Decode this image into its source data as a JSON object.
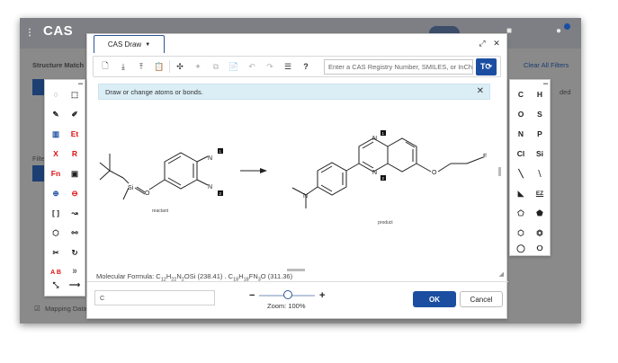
{
  "background": {
    "logo": "CAS",
    "left_panel": {
      "structure_match": "Structure Match",
      "clear_all_filters": "Clear All Filters",
      "filter_label": "Filte",
      "mapping_data": "Mapping Data",
      "right_dropdown": "ded"
    }
  },
  "dialog": {
    "tab_label": "CAS Draw",
    "expand_icon": "expand-icon",
    "close_icon": "close-icon",
    "search": {
      "placeholder": "Enter a CAS Registry Number, SMILES, or InChI..."
    },
    "info_message": "Draw or change atoms or bonds.",
    "reactant_label": "reactant",
    "product_label": "product",
    "atom_labels": {
      "n": "N",
      "si": "Si",
      "o": "O",
      "f": "F",
      "map1": "1",
      "map2": "2"
    },
    "formula": {
      "prefix": "Molecular Formula: ",
      "r_c": "C",
      "r_c_sub": "12",
      "r_h": "H",
      "r_h_sub": "22",
      "r_n": "N",
      "r_n_sub": "2",
      "r_rest": "OSi (238.41) . ",
      "p_c": "C",
      "p_c_sub": "18",
      "p_h": "H",
      "p_h_sub": "18",
      "p_n": "FN",
      "p_n_sub": "3",
      "p_rest": "O (311.36)"
    },
    "bottom_input_value": "C",
    "zoom_label": "Zoom: 100%",
    "zoom_value_percent": 100,
    "ok_label": "OK",
    "cancel_label": "Cancel"
  },
  "left_palette": {
    "et_label": "Et",
    "x_label": "X",
    "r_label": "R",
    "fn_label": "Fn",
    "ab_label": "A B"
  },
  "right_palette": {
    "atoms": [
      "C",
      "H",
      "O",
      "S",
      "N",
      "P",
      "Cl",
      "Si"
    ],
    "ez_label": "EZ"
  },
  "colors": {
    "accent": "#1b4ea1",
    "info_bg": "#dbeef6",
    "red": "#d11"
  }
}
